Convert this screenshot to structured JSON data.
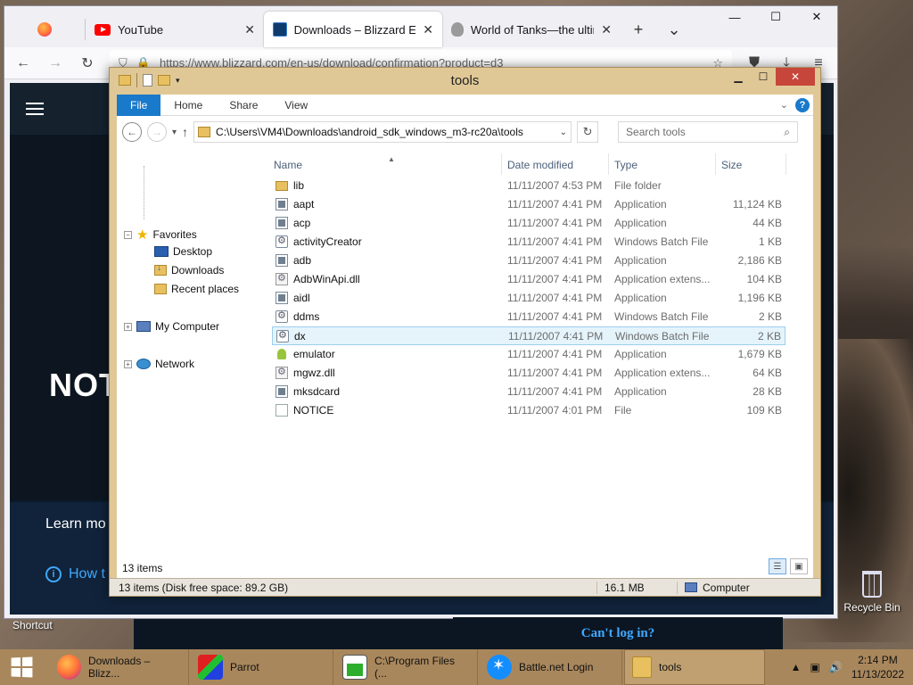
{
  "browser": {
    "tabs": [
      {
        "label": "",
        "icon": "firefox-icon"
      },
      {
        "label": "YouTube",
        "icon": "youtube-icon"
      },
      {
        "label": "Downloads – Blizzard Entert",
        "icon": "blizzard-icon"
      },
      {
        "label": "World of Tanks—the ultimat",
        "icon": "world-of-tanks-icon"
      }
    ],
    "url": "https://www.blizzard.com/en-us/download/confirmation?product=d3",
    "page": {
      "notice": "NOT",
      "learn_more": "Learn mo",
      "how_to": "How t",
      "cant_login": "Can't log in?",
      "shortcut": "Shortcut"
    }
  },
  "explorer": {
    "title": "tools",
    "ribbon_tabs": [
      "File",
      "Home",
      "Share",
      "View"
    ],
    "address": "C:\\Users\\VM4\\Downloads\\android_sdk_windows_m3-rc20a\\tools",
    "search_placeholder": "Search tools",
    "nav": {
      "favorites": "Favorites",
      "desktop": "Desktop",
      "downloads": "Downloads",
      "recent": "Recent places",
      "computer": "My Computer",
      "network": "Network"
    },
    "columns": {
      "name": "Name",
      "date": "Date modified",
      "type": "Type",
      "size": "Size"
    },
    "files": [
      {
        "name": "lib",
        "date": "11/11/2007 4:53 PM",
        "type": "File folder",
        "size": "",
        "icon": "folder"
      },
      {
        "name": "aapt",
        "date": "11/11/2007 4:41 PM",
        "type": "Application",
        "size": "11,124 KB",
        "icon": "app"
      },
      {
        "name": "acp",
        "date": "11/11/2007 4:41 PM",
        "type": "Application",
        "size": "44 KB",
        "icon": "app"
      },
      {
        "name": "activityCreator",
        "date": "11/11/2007 4:41 PM",
        "type": "Windows Batch File",
        "size": "1 KB",
        "icon": "bat"
      },
      {
        "name": "adb",
        "date": "11/11/2007 4:41 PM",
        "type": "Application",
        "size": "2,186 KB",
        "icon": "app"
      },
      {
        "name": "AdbWinApi.dll",
        "date": "11/11/2007 4:41 PM",
        "type": "Application extens...",
        "size": "104 KB",
        "icon": "dll"
      },
      {
        "name": "aidl",
        "date": "11/11/2007 4:41 PM",
        "type": "Application",
        "size": "1,196 KB",
        "icon": "app"
      },
      {
        "name": "ddms",
        "date": "11/11/2007 4:41 PM",
        "type": "Windows Batch File",
        "size": "2 KB",
        "icon": "bat"
      },
      {
        "name": "dx",
        "date": "11/11/2007 4:41 PM",
        "type": "Windows Batch File",
        "size": "2 KB",
        "icon": "bat",
        "selected": true
      },
      {
        "name": "emulator",
        "date": "11/11/2007 4:41 PM",
        "type": "Application",
        "size": "1,679 KB",
        "icon": "android"
      },
      {
        "name": "mgwz.dll",
        "date": "11/11/2007 4:41 PM",
        "type": "Application extens...",
        "size": "64 KB",
        "icon": "dll"
      },
      {
        "name": "mksdcard",
        "date": "11/11/2007 4:41 PM",
        "type": "Application",
        "size": "28 KB",
        "icon": "app"
      },
      {
        "name": "NOTICE",
        "date": "11/11/2007 4:01 PM",
        "type": "File",
        "size": "109 KB",
        "icon": "file"
      }
    ],
    "items_count": "13 items",
    "status": {
      "summary": "13 items (Disk free space: 89.2 GB)",
      "size": "16.1 MB",
      "location": "Computer"
    }
  },
  "desktop": {
    "recycle_bin": "Recycle Bin"
  },
  "taskbar": {
    "items": [
      {
        "label": "Downloads – Blizz...",
        "icon": "firefox-icon"
      },
      {
        "label": "Parrot",
        "icon": "parrot-icon"
      },
      {
        "label": "C:\\Program Files (...",
        "icon": "program-icon"
      },
      {
        "label": "Battle.net Login",
        "icon": "battlenet-icon"
      },
      {
        "label": "tools",
        "icon": "folder-icon"
      }
    ],
    "time": "2:14 PM",
    "date": "11/13/2022"
  }
}
